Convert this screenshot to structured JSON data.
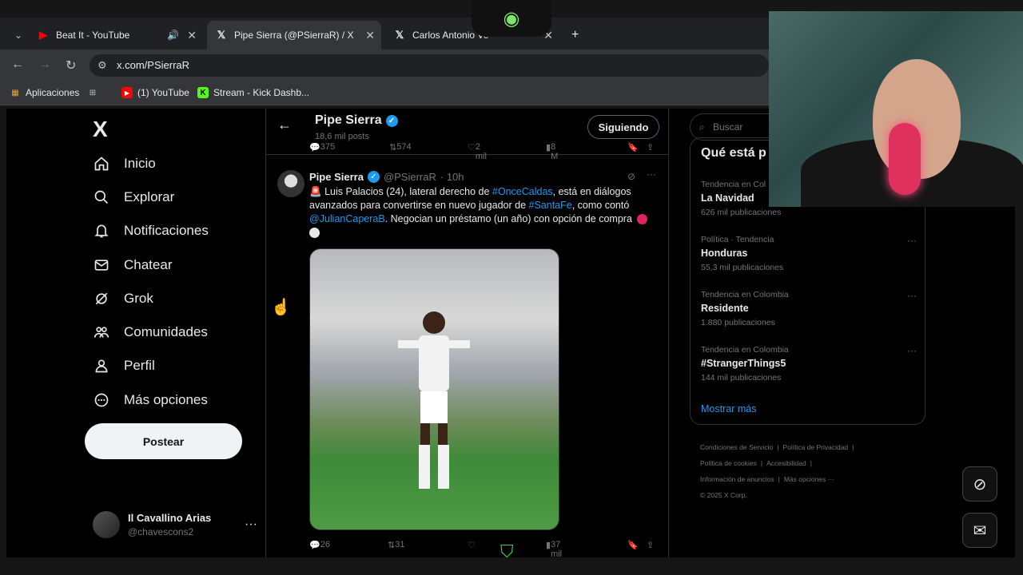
{
  "browser": {
    "tabs": [
      {
        "title": "Beat It - YouTube",
        "icon": "youtube-icon"
      },
      {
        "title": "Pipe Sierra (@PSierraR) / X",
        "icon": "x-icon"
      },
      {
        "title": "Carlos Antonio Ve",
        "icon": "x-icon"
      }
    ],
    "url": "x.com/PSierraR",
    "bookmarks": [
      {
        "label": "Aplicaciones"
      },
      {
        "label": "(1) YouTube"
      },
      {
        "label": "Stream - Kick Dashb..."
      }
    ]
  },
  "nav": {
    "logo": "X",
    "items": [
      {
        "label": "Inicio",
        "icon": "home-icon"
      },
      {
        "label": "Explorar",
        "icon": "search-icon"
      },
      {
        "label": "Notificaciones",
        "icon": "bell-icon"
      },
      {
        "label": "Chatear",
        "icon": "mail-icon"
      },
      {
        "label": "Grok",
        "icon": "grok-icon"
      },
      {
        "label": "Comunidades",
        "icon": "people-icon"
      },
      {
        "label": "Perfil",
        "icon": "person-icon"
      },
      {
        "label": "Más opciones",
        "icon": "more-circle-icon"
      }
    ],
    "post_label": "Postear",
    "account": {
      "name": "Il Cavallino Arias",
      "handle": "@chavescons2"
    }
  },
  "profile_header": {
    "name": "Pipe Sierra",
    "posts": "18,6 mil posts",
    "follow_label": "Siguiendo"
  },
  "prev_tweet_actions": {
    "replies": "375",
    "reposts": "574",
    "likes": "2 mil",
    "views": "8 M"
  },
  "tweet": {
    "author": "Pipe Sierra",
    "handle": "@PSierraR",
    "time": "· 10h",
    "text_1": "Luis Palacios (24), lateral derecho de ",
    "tag_1": "#OnceCaldas",
    "text_2": ", está en diálogos avanzados para convertirse en nuevo jugador de ",
    "tag_2": "#SantaFe",
    "text_3": ", como contó ",
    "tag_3": "@JulianCaperaB",
    "text_4": ". Negocian un préstamo (un año) con opción de compra",
    "actions": {
      "replies": "26",
      "reposts": "31",
      "likes": "",
      "views": "37 mil"
    }
  },
  "sidebar": {
    "search_placeholder": "Buscar",
    "trends_title": "Qué está p",
    "trends": [
      {
        "context": "Tendencia en Col",
        "title": "La Navidad",
        "count": "626 mil publicaciones"
      },
      {
        "context": "Política · Tendencia",
        "title": "Honduras",
        "count": "55,3 mil publicaciones"
      },
      {
        "context": "Tendencia en Colombia",
        "title": "Residente",
        "count": "1.880 publicaciones"
      },
      {
        "context": "Tendencia en Colombia",
        "title": "#StrangerThings5",
        "count": "144 mil publicaciones"
      }
    ],
    "show_more": "Mostrar más",
    "footer": [
      "Condiciones de Servicio",
      "|",
      "Política de Privacidad",
      "|",
      "Política de cookies",
      "|",
      "Accesibilidad",
      "|",
      "Información de anuncios",
      "|",
      "Más opciones ···",
      "© 2025 X Corp."
    ]
  }
}
